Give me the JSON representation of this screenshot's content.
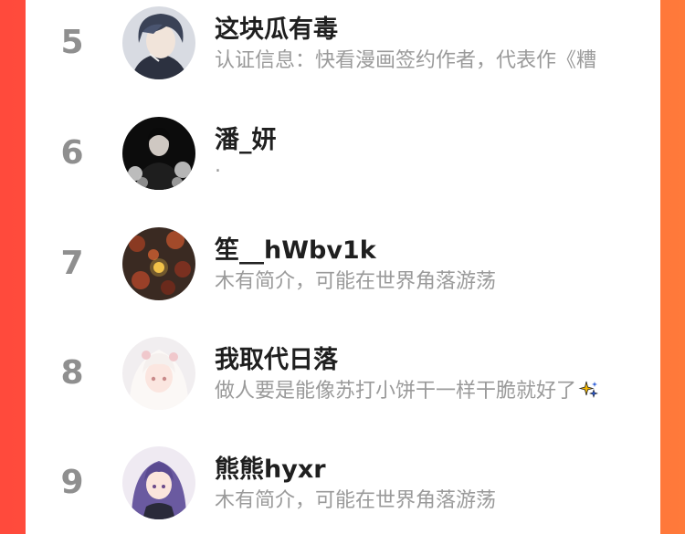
{
  "users": [
    {
      "rank": "5",
      "name": "这块瓜有毒",
      "bio": "认证信息：快看漫画签约作者，代表作《糟",
      "avatar": "dark-haired-boy-avatar"
    },
    {
      "rank": "6",
      "name": "潘_妍",
      "bio": ".",
      "avatar": "dark-portrait-avatar"
    },
    {
      "rank": "7",
      "name": "笙__hWbv1k",
      "bio": "木有简介，可能在世界角落游荡",
      "avatar": "autumn-leaves-avatar"
    },
    {
      "rank": "8",
      "name": "我取代日落",
      "bio": "做人要是能像苏打小饼干一样干脆就好了",
      "avatar": "white-haired-girl-avatar",
      "bio_emoji": "sparkles-icon"
    },
    {
      "rank": "9",
      "name": "熊熊hyxr",
      "bio": "木有简介，可能在世界角落游荡",
      "avatar": "purple-haired-girl-avatar"
    }
  ]
}
